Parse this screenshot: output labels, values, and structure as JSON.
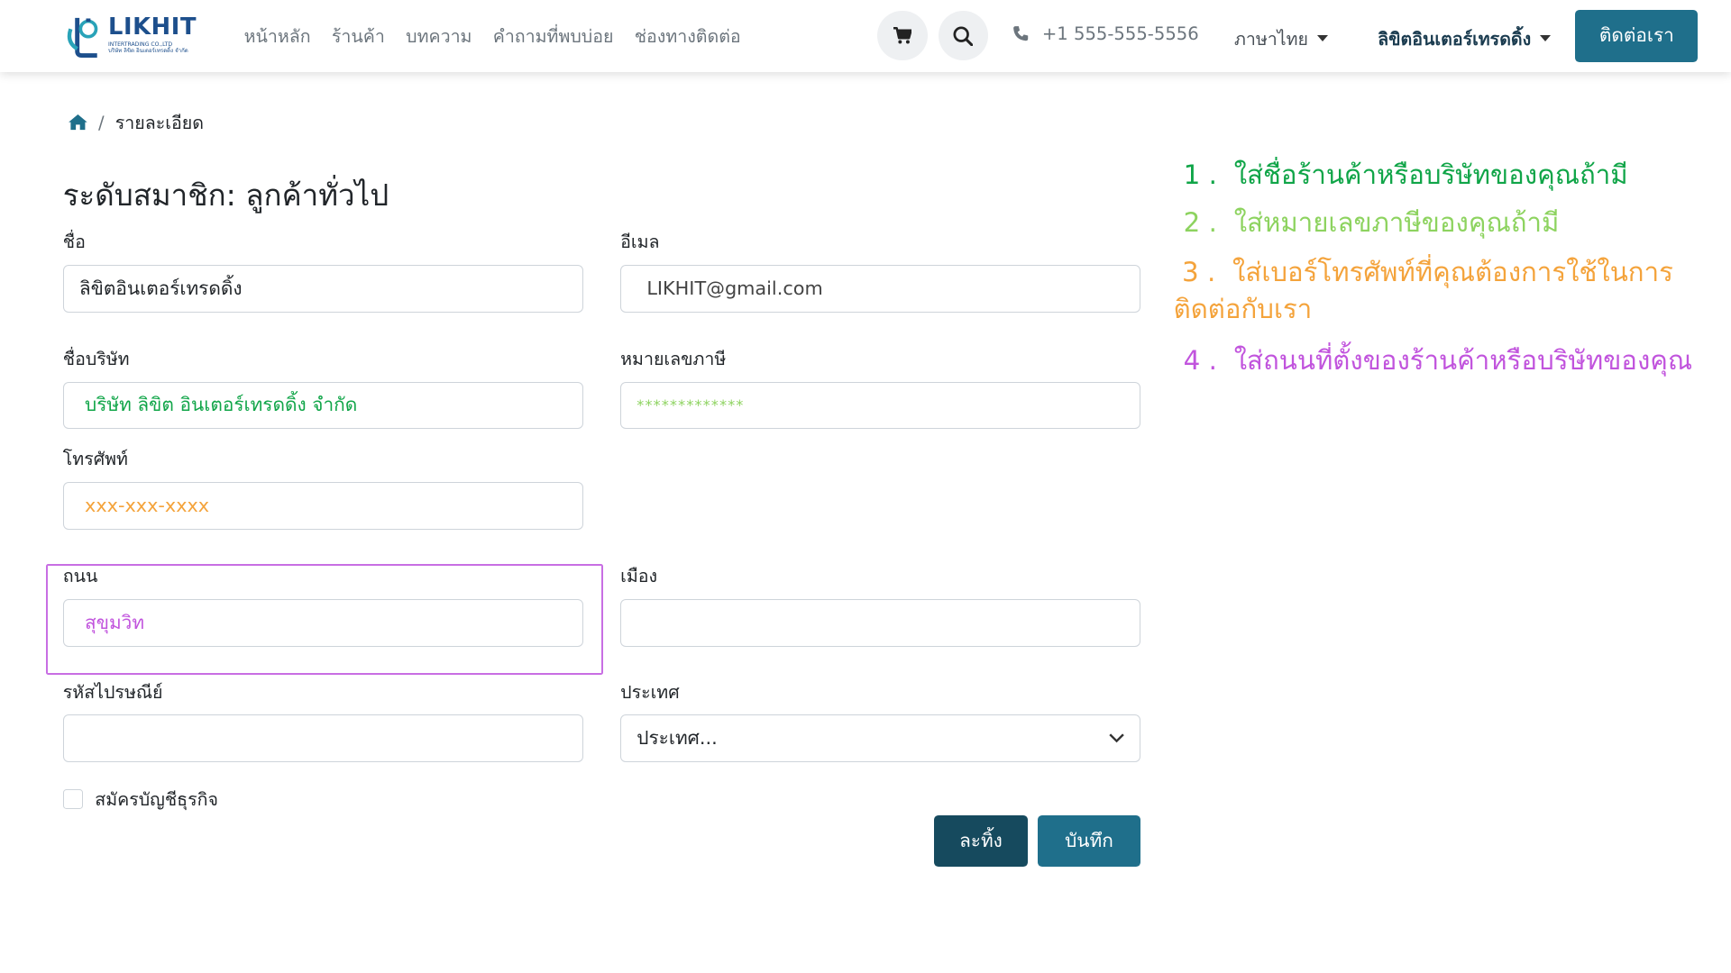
{
  "header": {
    "logo_text": "LIKHIT",
    "logo_sub": "INTERTRADING CO.,LTD",
    "logo_sub_thai": "บริษัท ลิขิต อินเตอร์เทรดดิ้ง จำกัด",
    "nav": [
      "หน้าหลัก",
      "ร้านค้า",
      "บทความ",
      "คำถามที่พบบ่อย",
      "ช่องทางติดต่อ"
    ],
    "phone": "+1 555-555-5556",
    "language": "ภาษาไทย",
    "user_name": "ลิขิตอินเตอร์เทรดดิ้ง",
    "contact_button": "ติดต่อเรา"
  },
  "breadcrumb": {
    "current": "รายละเอียด"
  },
  "form": {
    "title": "ระดับสมาชิก: ลูกค้าทั่วไป",
    "name_label": "ชื่อ",
    "name_value": "ลิขิตอินเตอร์เทรดดิ้ง",
    "email_label": "อีเมล",
    "email_value": "LIKHIT@gmail.com",
    "company_label": "ชื่อบริษัท",
    "company_value": "บริษัท ลิขิต อินเตอร์เทรดดิ้ง จำกัด",
    "tax_label": "หมายเลขภาษี",
    "tax_value": "*************",
    "phone_label": "โทรศัพท์",
    "phone_value": "xxx-xxx-xxxx",
    "street_label": "ถนน",
    "street_value": "สุขุมวิท",
    "city_label": "เมือง",
    "city_value": "",
    "zip_label": "รหัสไปรษณีย์",
    "zip_value": "",
    "country_label": "ประเทศ",
    "country_selected": "ประเทศ...",
    "business_account_label": "สมัครบัญชีธุรกิจ",
    "discard_button": "ละทิ้ง",
    "save_button": "บันทึก"
  },
  "instructions": [
    {
      "num": "1 .",
      "text": "ใส่ชื่อร้านค้าหรือบริษัทของคุณถ้ามี",
      "color": "#10a548"
    },
    {
      "num": "2 .",
      "text": "ใส่หมายเลขภาษีของคุณถ้ามี",
      "color": "#8dd35f"
    },
    {
      "num": "3 .",
      "text": "ใส่เบอร์โทรศัพท์ที่คุณต้องการใช้ในการติดต่อกับเรา",
      "color": "#f4a33b"
    },
    {
      "num": "4 .",
      "text": "ใส่ถนนที่ตั้งของร้านค้าหรือบริษัทของคุณ",
      "color": "#c154dd"
    }
  ],
  "colors": {
    "primary": "#1f6f8b",
    "primary_dark": "#164a5e",
    "highlight": "#c86ee3"
  }
}
